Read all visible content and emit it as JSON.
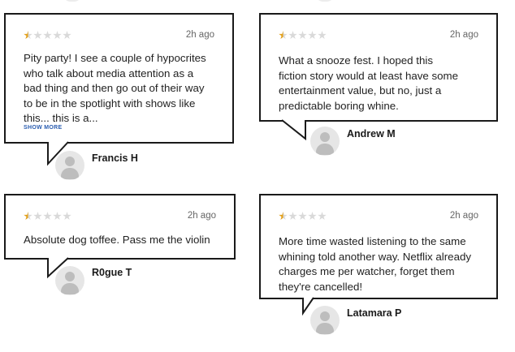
{
  "reviews": [
    {
      "author": "Francis H",
      "time": "2h ago",
      "rating": 0.5,
      "text": "Pity party! I see a couple of hypocrites who talk about media attention as a bad thing and then go out of their way to be in the spotlight with shows like this... this is a...",
      "show_more": "SHOW MORE"
    },
    {
      "author": "Andrew M",
      "time": "2h ago",
      "rating": 0.5,
      "text": "What a snooze fest. I hoped this fiction story would at least have some entertainment value, but no, just a predictable boring whine."
    },
    {
      "author": "R0gue T",
      "time": "2h ago",
      "rating": 0.5,
      "text": "Absolute dog toffee. Pass me the violin"
    },
    {
      "author": "Latamara P",
      "time": "2h ago",
      "rating": 0.5,
      "text": "More time wasted listening to the same whining told another way. Netflix already charges me per watcher, forget them they're cancelled!"
    }
  ],
  "colors": {
    "star_filled": "#e3a11c",
    "star_empty": "#d9d9d9",
    "border": "#1a1a1a",
    "link": "#2a5db0"
  },
  "icons": [
    "star-icon",
    "avatar-icon"
  ]
}
